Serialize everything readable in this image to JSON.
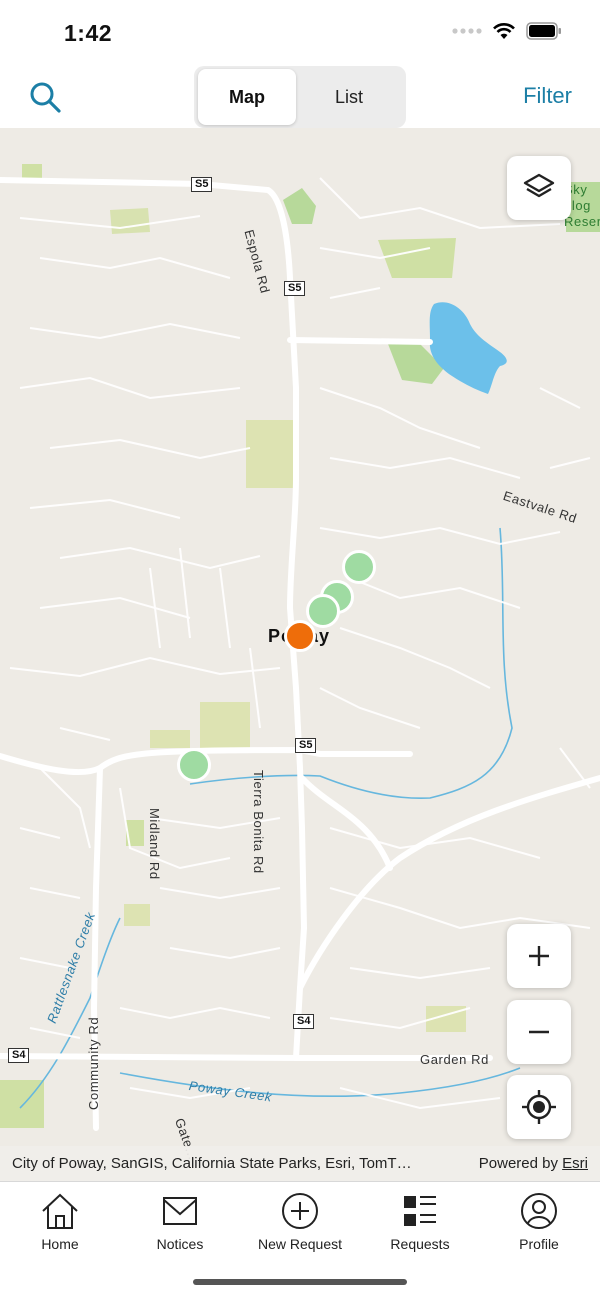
{
  "status_bar": {
    "time": "1:42"
  },
  "nav": {
    "search_icon": "search-icon",
    "segments": [
      {
        "label": "Map",
        "active": true
      },
      {
        "label": "List",
        "active": false
      }
    ],
    "filter_label": "Filter",
    "accent_color": "#1c7fa6"
  },
  "map": {
    "place_label": "Poway",
    "road_labels": {
      "espola": "Espola Rd",
      "eastvale": "Eastvale Rd",
      "tierra_bonita": "Tierra Bonita Rd",
      "midland": "Midland Rd",
      "community": "Community Rd",
      "garden": "Garden Rd",
      "gate": "Gate...",
      "rattlesnake_creek": "Rattlesnake Creek",
      "poway_creek": "Poway Creek",
      "reserve": "Sky\nolog\nReser"
    },
    "shields": {
      "s5_top": "S5",
      "s5_mid": "S5",
      "s5_low": "S5",
      "s4_center": "S4",
      "s4_left": "S4"
    },
    "markers": [
      {
        "status": "open",
        "color": "#9fdba2"
      },
      {
        "status": "open",
        "color": "#9fdba2"
      },
      {
        "status": "open",
        "color": "#9fdba2"
      },
      {
        "status": "open",
        "color": "#9fdba2"
      },
      {
        "status": "selected",
        "color": "#ee6d0a"
      }
    ],
    "controls": {
      "layers_icon": "layers-icon",
      "zoom_in_icon": "plus-icon",
      "zoom_out_icon": "minus-icon",
      "locate_icon": "locate-icon"
    },
    "attribution": "City of Poway, SanGIS, California State Parks, Esri, TomT…",
    "powered_by": "Powered by",
    "powered_by_link": "Esri"
  },
  "tab_bar": {
    "items": [
      {
        "label": "Home",
        "icon": "home-icon"
      },
      {
        "label": "Notices",
        "icon": "envelope-icon"
      },
      {
        "label": "New Request",
        "icon": "plus-circle-icon"
      },
      {
        "label": "Requests",
        "icon": "list-icon"
      },
      {
        "label": "Profile",
        "icon": "person-icon"
      }
    ]
  }
}
